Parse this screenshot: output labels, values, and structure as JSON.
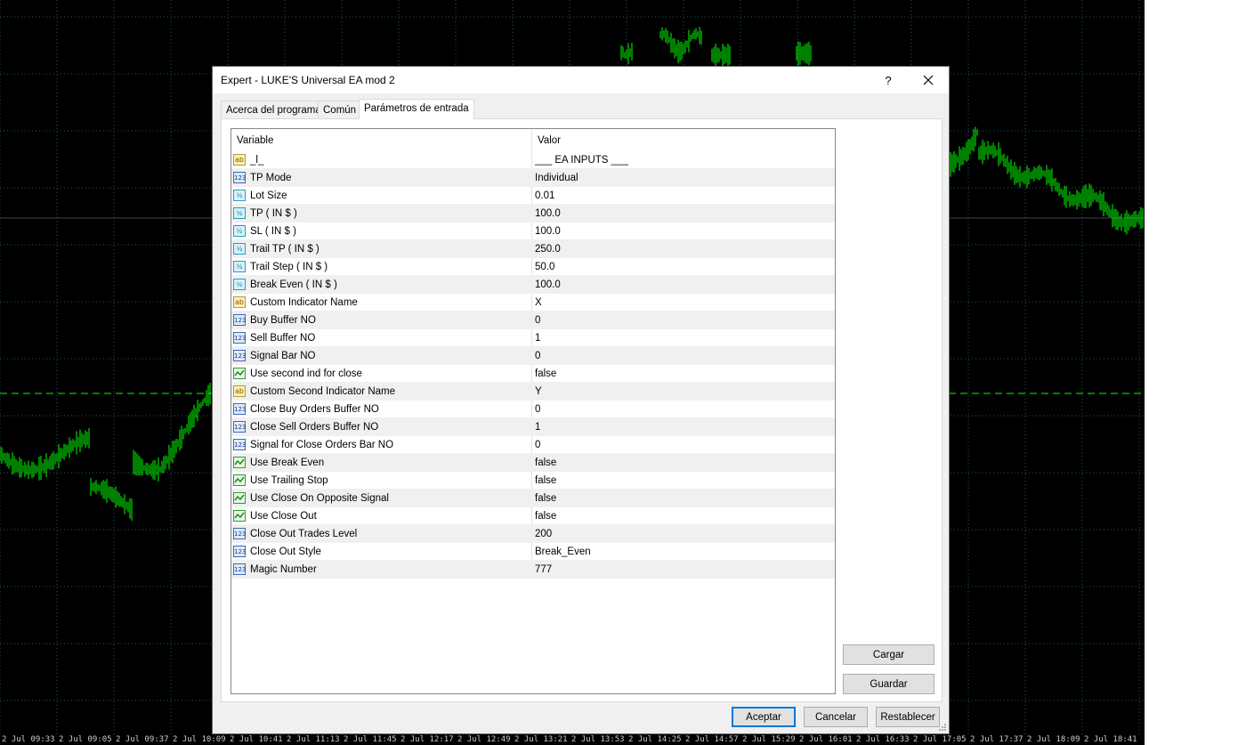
{
  "window": {
    "title": "Expert - LUKE'S Universal EA mod 2",
    "help_label": "?",
    "close_icon": "close-icon"
  },
  "tabs": [
    {
      "label": "Acerca del programa"
    },
    {
      "label": "Común"
    },
    {
      "label": "Parámetros de entrada",
      "active": true
    }
  ],
  "grid": {
    "col_variable": "Variable",
    "col_value": "Valor",
    "rows": [
      {
        "type": "string",
        "name": "_l_",
        "value": "___ EA INPUTS ___"
      },
      {
        "type": "int",
        "name": "TP Mode",
        "value": "Individual"
      },
      {
        "type": "double",
        "name": "Lot Size",
        "value": "0.01"
      },
      {
        "type": "double",
        "name": "TP ( IN $ )",
        "value": "100.0"
      },
      {
        "type": "double",
        "name": "SL ( IN $ )",
        "value": "100.0"
      },
      {
        "type": "double",
        "name": "Trail TP ( IN $ )",
        "value": "250.0"
      },
      {
        "type": "double",
        "name": "Trail Step ( IN $ )",
        "value": "50.0"
      },
      {
        "type": "double",
        "name": "Break Even ( IN $ )",
        "value": "100.0"
      },
      {
        "type": "string",
        "name": "Custom Indicator Name",
        "value": "X"
      },
      {
        "type": "int",
        "name": "Buy Buffer NO",
        "value": "0"
      },
      {
        "type": "int",
        "name": "Sell Buffer NO",
        "value": "1"
      },
      {
        "type": "int",
        "name": "Signal Bar NO",
        "value": "0"
      },
      {
        "type": "bool",
        "name": "Use second ind for close",
        "value": "false"
      },
      {
        "type": "string",
        "name": "Custom Second Indicator Name",
        "value": "Y"
      },
      {
        "type": "int",
        "name": "Close Buy Orders Buffer NO",
        "value": "0"
      },
      {
        "type": "int",
        "name": "Close Sell Orders Buffer NO",
        "value": "1"
      },
      {
        "type": "int",
        "name": "Signal for Close Orders Bar NO",
        "value": "0"
      },
      {
        "type": "bool",
        "name": "Use Break Even",
        "value": "false"
      },
      {
        "type": "bool",
        "name": "Use Trailing Stop",
        "value": "false"
      },
      {
        "type": "bool",
        "name": "Use Close On Opposite Signal",
        "value": "false"
      },
      {
        "type": "bool",
        "name": "Use Close Out",
        "value": "false"
      },
      {
        "type": "int",
        "name": "Close Out Trades Level",
        "value": "200"
      },
      {
        "type": "int",
        "name": "Close Out Style",
        "value": "Break_Even"
      },
      {
        "type": "int",
        "name": "Magic Number",
        "value": "777"
      }
    ]
  },
  "side_buttons": {
    "load": "Cargar",
    "save": "Guardar"
  },
  "footer_buttons": {
    "ok": "Aceptar",
    "cancel": "Cancelar",
    "reset": "Restablecer"
  },
  "icon_glyphs": {
    "string": "ab",
    "int": "123",
    "double": "½",
    "bool": "✓"
  },
  "time_axis": [
    "2 Jul 09:33",
    "2 Jul 09:05",
    "2 Jul 09:37",
    "2 Jul 10:09",
    "2 Jul 10:41",
    "2 Jul 11:13",
    "2 Jul 11:45",
    "2 Jul 12:17",
    "2 Jul 12:49",
    "2 Jul 13:21",
    "2 Jul 13:53",
    "2 Jul 14:25",
    "2 Jul 14:57",
    "2 Jul 15:29",
    "2 Jul 16:01",
    "2 Jul 16:33",
    "2 Jul 17:05",
    "2 Jul 17:37",
    "2 Jul 18:09",
    "2 Jul 18:41"
  ],
  "colors": {
    "chart_bg": "#000000",
    "candles": "#00ff00",
    "grid": "#1e5a6a",
    "level_line": "#00ff00",
    "default_button": "#0078d7"
  }
}
